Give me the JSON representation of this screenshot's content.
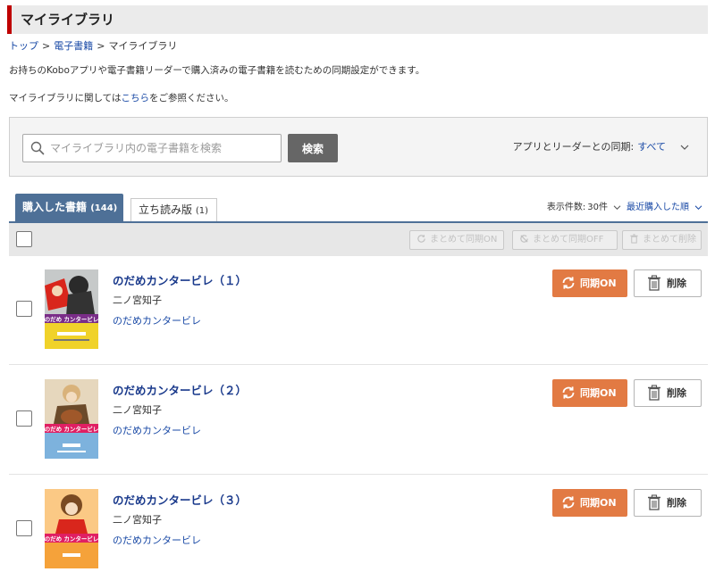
{
  "page": {
    "title": "マイライブラリ"
  },
  "breadcrumb": {
    "items": [
      "トップ",
      "電子書籍"
    ],
    "current": "マイライブラリ",
    "separator": ">"
  },
  "intro": {
    "description": "お持ちのKoboアプリや電子書籍リーダーで購入済みの電子書籍を読むための同期設定ができます。",
    "refer_prefix": "マイライブラリに関しては",
    "refer_link": "こちら",
    "refer_suffix": "をご参照ください。"
  },
  "search": {
    "placeholder": "マイライブラリ内の電子書籍を検索",
    "value": "",
    "button_label": "検索",
    "sync_filter_label": "アプリとリーダーとの同期:",
    "sync_filter_value": "すべて"
  },
  "tabs": [
    {
      "label": "購入した書籍",
      "count": "(144)",
      "active": true
    },
    {
      "label": "立ち読み版",
      "count": "(1)",
      "active": false
    }
  ],
  "display": {
    "per_page_label": "表示件数:",
    "per_page_value": "30件",
    "sort_value": "最近購入した順"
  },
  "bulk": {
    "sync_on_label": "まとめて同期ON",
    "sync_off_label": "まとめて同期OFF",
    "delete_label": "まとめて削除"
  },
  "books": [
    {
      "title": "のだめカンタービレ（１）",
      "author": "二ノ宮知子",
      "series": "のだめカンタービレ",
      "sync_label": "同期ON",
      "delete_label": "削除"
    },
    {
      "title": "のだめカンタービレ（２）",
      "author": "二ノ宮知子",
      "series": "のだめカンタービレ",
      "sync_label": "同期ON",
      "delete_label": "削除"
    },
    {
      "title": "のだめカンタービレ（３）",
      "author": "二ノ宮知子",
      "series": "のだめカンタービレ",
      "sync_label": "同期ON",
      "delete_label": "削除"
    }
  ],
  "colors": {
    "title_accent": "#bf0000",
    "tab_active": "#4e7097",
    "sync_button": "#e27a43",
    "link": "#1a4aa6",
    "book_title": "#1a3a8c"
  },
  "icons": {
    "search": "magnifier-icon",
    "sync": "sync-arrows-icon",
    "sync_off": "sync-off-icon",
    "delete": "trash-icon",
    "chevron": "chevron-down-icon"
  }
}
